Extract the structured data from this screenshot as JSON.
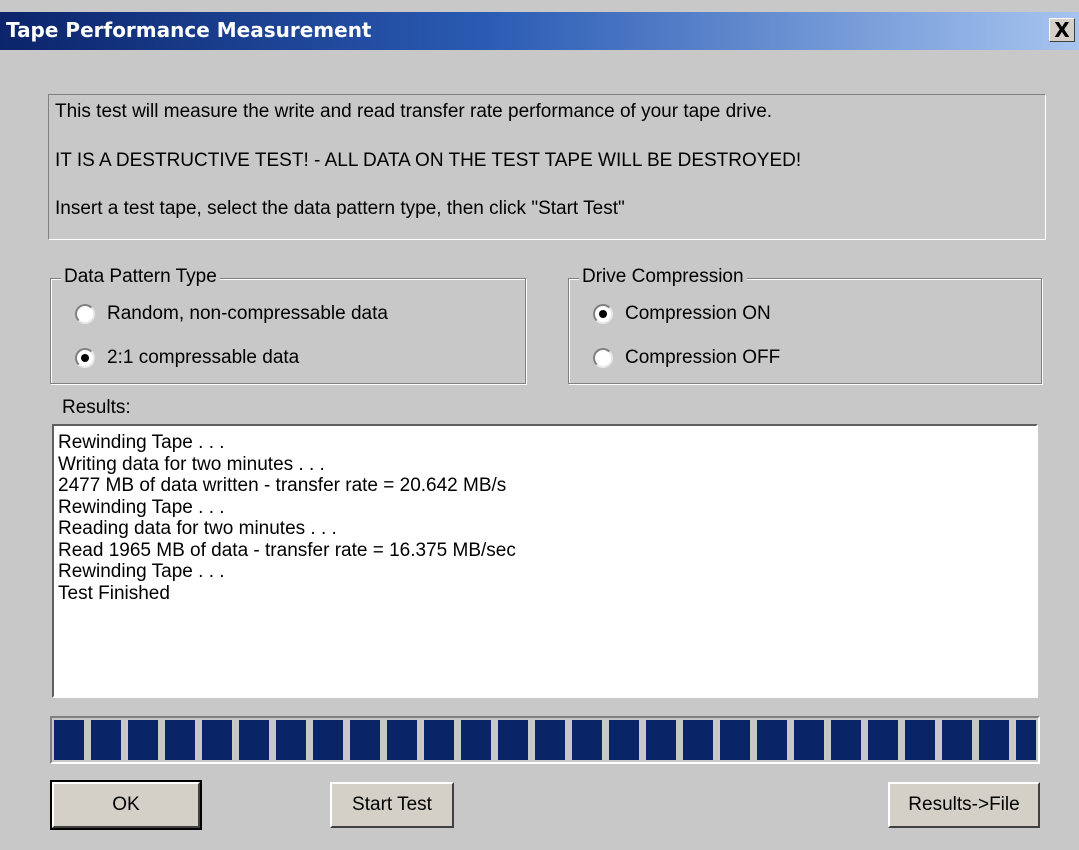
{
  "window": {
    "title": "Tape Performance Measurement",
    "close_glyph": "X"
  },
  "info": {
    "line1": "This test will measure the write and read transfer rate performance of your tape drive.",
    "line2": "IT IS A DESTRUCTIVE TEST! - ALL DATA ON THE TEST TAPE WILL BE DESTROYED!",
    "line3": "Insert a test tape, select the data pattern type, then click \"Start Test\""
  },
  "data_pattern": {
    "label": "Data Pattern Type",
    "options": [
      {
        "label": "Random, non-compressable data",
        "checked": false
      },
      {
        "label": "2:1 compressable data",
        "checked": true
      }
    ]
  },
  "compression": {
    "label": "Drive Compression",
    "options": [
      {
        "label": "Compression ON",
        "checked": true
      },
      {
        "label": "Compression OFF",
        "checked": false
      }
    ]
  },
  "results": {
    "label": "Results:",
    "lines": [
      "Rewinding Tape . . .",
      "Writing data for two minutes . . .",
      "2477 MB of data written - transfer rate = 20.642 MB/s",
      "Rewinding Tape . . .",
      "Reading data for two minutes . . .",
      "Read 1965 MB of data - transfer rate = 16.375 MB/sec",
      "Rewinding Tape . . .",
      "Test Finished"
    ]
  },
  "progress": {
    "percent": 100,
    "color": "#0a2468"
  },
  "buttons": {
    "ok": "OK",
    "start": "Start Test",
    "results_file": "Results->File"
  }
}
